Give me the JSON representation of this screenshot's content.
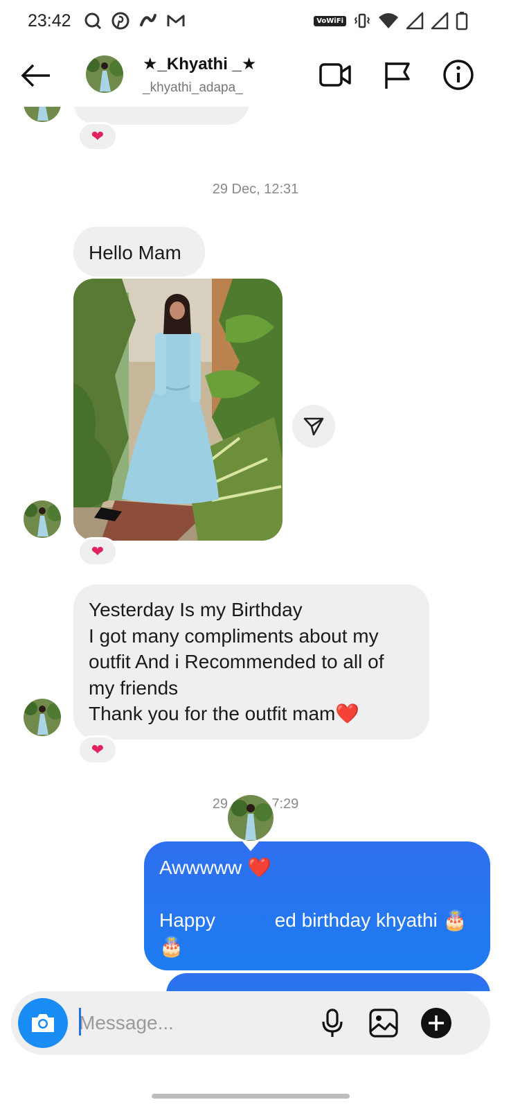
{
  "status_bar": {
    "time": "23:42",
    "left_icons": [
      "search-circle-icon",
      "pinterest-icon",
      "app-icon",
      "gmail-icon"
    ],
    "volte_badge": "VoWiFi",
    "right_icons": [
      "vibrate-icon",
      "wifi-icon",
      "signal-icon",
      "signal-icon",
      "battery-icon"
    ]
  },
  "header": {
    "display_name": "★_Khyathi _★",
    "username": "_khyathi_adapa_",
    "actions": [
      "video-call",
      "report-flag",
      "info"
    ]
  },
  "chat": {
    "messages": [
      {
        "id": "m0",
        "direction": "incoming",
        "type": "text-cut-off",
        "reaction": "❤"
      },
      {
        "id": "ts1",
        "type": "timestamp",
        "text": "29 Dec, 12:31"
      },
      {
        "id": "m1",
        "direction": "incoming",
        "type": "text",
        "text": "Hello Mam"
      },
      {
        "id": "m2",
        "direction": "incoming",
        "type": "photo",
        "reaction": "❤"
      },
      {
        "id": "m3",
        "direction": "incoming",
        "type": "text",
        "lines": [
          "Yesterday Is my Birthday",
          "I got many compliments about my",
          "outfit And i Recommended to all of",
          "my friends",
          "Thank you for the outfit mam❤️"
        ],
        "reaction": "❤"
      },
      {
        "id": "ts2",
        "type": "timestamp",
        "text": "29 Dec, 17:29"
      },
      {
        "id": "m4",
        "direction": "outgoing",
        "type": "text",
        "line1": "Awwwww ❤️",
        "line2_start": "Happy ",
        "line2_end": "ed birthday khyathi 🎂",
        "line3": "🎂"
      }
    ]
  },
  "composer": {
    "placeholder": "Message..."
  },
  "colors": {
    "outgoing_bubble": "#2f6ff0",
    "incoming_bubble": "#efefef",
    "camera_button": "#1a8cf5",
    "heart": "#e0245e"
  }
}
